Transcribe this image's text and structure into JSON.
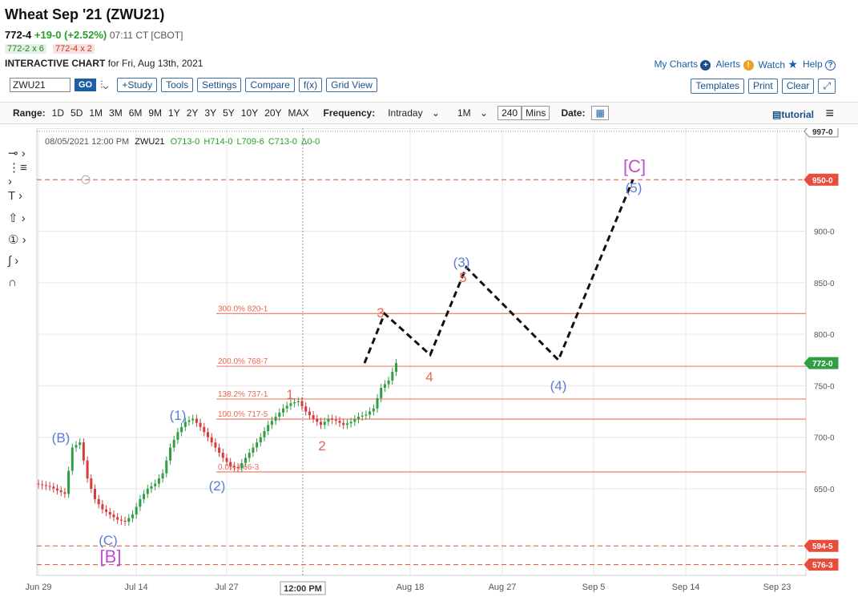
{
  "header": {
    "title": "Wheat Sep '21 (ZWU21)",
    "last": "772-4",
    "change": "+19-0 (+2.52%)",
    "time": "07:11 CT [CBOT]",
    "bid": "772-2 x 6",
    "ask": "772-4 x 2",
    "chart_label": "INTERACTIVE CHART",
    "chart_date": "for Fri, Aug 13th, 2021"
  },
  "links": {
    "my_charts": "My Charts",
    "alerts": "Alerts",
    "watch": "Watch",
    "help": "Help"
  },
  "toolbar": {
    "symbol": "ZWU21",
    "go": "GO",
    "study": "+Study",
    "tools": "Tools",
    "settings": "Settings",
    "compare": "Compare",
    "fx": "f(x)",
    "grid_view": "Grid View",
    "templates": "Templates",
    "print": "Print",
    "clear": "Clear"
  },
  "rangebar": {
    "range_label": "Range:",
    "ranges": [
      "1D",
      "5D",
      "1M",
      "3M",
      "6M",
      "9M",
      "1Y",
      "2Y",
      "3Y",
      "5Y",
      "10Y",
      "20Y",
      "MAX"
    ],
    "frequency_label": "Frequency:",
    "frequency": "Intraday",
    "period": "1M",
    "interval": "240",
    "interval_unit": "Mins",
    "date_label": "Date:",
    "tutorial": "tutorial"
  },
  "icons": {
    "alert": "alert-icon",
    "watch": "star-icon",
    "help": "question-icon",
    "calendar": "calendar-icon",
    "menu": "hamburger-icon"
  },
  "chart_data": {
    "type": "candlestick",
    "symbol": "ZWU21",
    "ohlc_readout": {
      "datetime": "08/05/2021 12:00 PM",
      "symbol": "ZWU21",
      "open": "O713-0",
      "high": "H714-0",
      "low": "L709-6",
      "close": "C713-0",
      "delta": "Δ0-0"
    },
    "y_ticks": [
      "650-0",
      "700-0",
      "750-0",
      "800-0",
      "850-0",
      "900-0"
    ],
    "y_tick_values": [
      650,
      700,
      750,
      800,
      850,
      900
    ],
    "ylim": [
      566,
      1000
    ],
    "x_ticks": [
      "Jun 29",
      "Jul 14",
      "Jul 27",
      "Aug 18",
      "Aug 27",
      "Sep 5",
      "Sep 14",
      "Sep 23"
    ],
    "crosshair_label": "12:00 PM",
    "price_boxes": [
      {
        "text": "997-0",
        "value": 997,
        "color": "#ffffff"
      },
      {
        "text": "950-0",
        "value": 950,
        "color": "#e74c3c"
      },
      {
        "text": "772-0",
        "value": 772,
        "color": "#2ea043"
      },
      {
        "text": "594-5",
        "value": 594.6,
        "color": "#e74c3c"
      },
      {
        "text": "576-3",
        "value": 576.4,
        "color": "#e74c3c"
      }
    ],
    "fib_levels": [
      {
        "label": "300.0% 820-1",
        "value": 820.1
      },
      {
        "label": "200.0% 768-7",
        "value": 768.9
      },
      {
        "label": "138.2% 737-1",
        "value": 737.1
      },
      {
        "label": "100.0% 717-5",
        "value": 717.6
      },
      {
        "label": "0.0% 666-3",
        "value": 666.4
      }
    ],
    "price_path": [
      [
        0,
        655
      ],
      [
        2,
        652
      ],
      [
        4,
        645
      ],
      [
        5,
        690
      ],
      [
        6,
        695
      ],
      [
        7,
        660
      ],
      [
        8,
        640
      ],
      [
        9,
        630
      ],
      [
        10,
        625
      ],
      [
        11,
        620
      ],
      [
        12,
        618
      ],
      [
        13,
        625
      ],
      [
        14,
        640
      ],
      [
        15,
        650
      ],
      [
        16,
        655
      ],
      [
        17,
        665
      ],
      [
        18,
        690
      ],
      [
        19,
        705
      ],
      [
        20,
        715
      ],
      [
        21,
        718
      ],
      [
        22,
        710
      ],
      [
        23,
        700
      ],
      [
        24,
        690
      ],
      [
        25,
        680
      ],
      [
        26,
        672
      ],
      [
        27,
        670
      ],
      [
        28,
        680
      ],
      [
        29,
        690
      ],
      [
        30,
        700
      ],
      [
        31,
        712
      ],
      [
        32,
        720
      ],
      [
        33,
        728
      ],
      [
        34,
        733
      ],
      [
        35,
        735
      ],
      [
        36,
        725
      ],
      [
        37,
        718
      ],
      [
        38,
        712
      ],
      [
        39,
        718
      ],
      [
        40,
        716
      ],
      [
        41,
        712
      ],
      [
        42,
        715
      ],
      [
        43,
        720
      ],
      [
        44,
        722
      ],
      [
        45,
        728
      ],
      [
        46,
        748
      ],
      [
        47,
        755
      ],
      [
        48,
        772
      ]
    ],
    "projection": [
      [
        48,
        772
      ],
      [
        50,
        820
      ],
      [
        56,
        780
      ],
      [
        60,
        865
      ],
      [
        71,
        775
      ],
      [
        79,
        950
      ]
    ],
    "wave_labels": [
      {
        "text": "(B)",
        "color": "#5b7bd5"
      },
      {
        "text": "(C)",
        "color": "#5b7bd5"
      },
      {
        "text": "[B]",
        "color": "#c04fd0"
      },
      {
        "text": "(1)",
        "color": "#5b7bd5"
      },
      {
        "text": "(2)",
        "color": "#5b7bd5"
      },
      {
        "text": "1",
        "color": "#e8664f"
      },
      {
        "text": "2",
        "color": "#e8664f"
      },
      {
        "text": "3",
        "color": "#e8664f"
      },
      {
        "text": "4",
        "color": "#e8664f"
      },
      {
        "text": "(3)",
        "color": "#5b7bd5"
      },
      {
        "text": "5",
        "color": "#e8664f"
      },
      {
        "text": "(4)",
        "color": "#5b7bd5"
      },
      {
        "text": "[C]",
        "color": "#c04fd0"
      },
      {
        "text": "(5)",
        "color": "#5b7bd5"
      }
    ]
  }
}
